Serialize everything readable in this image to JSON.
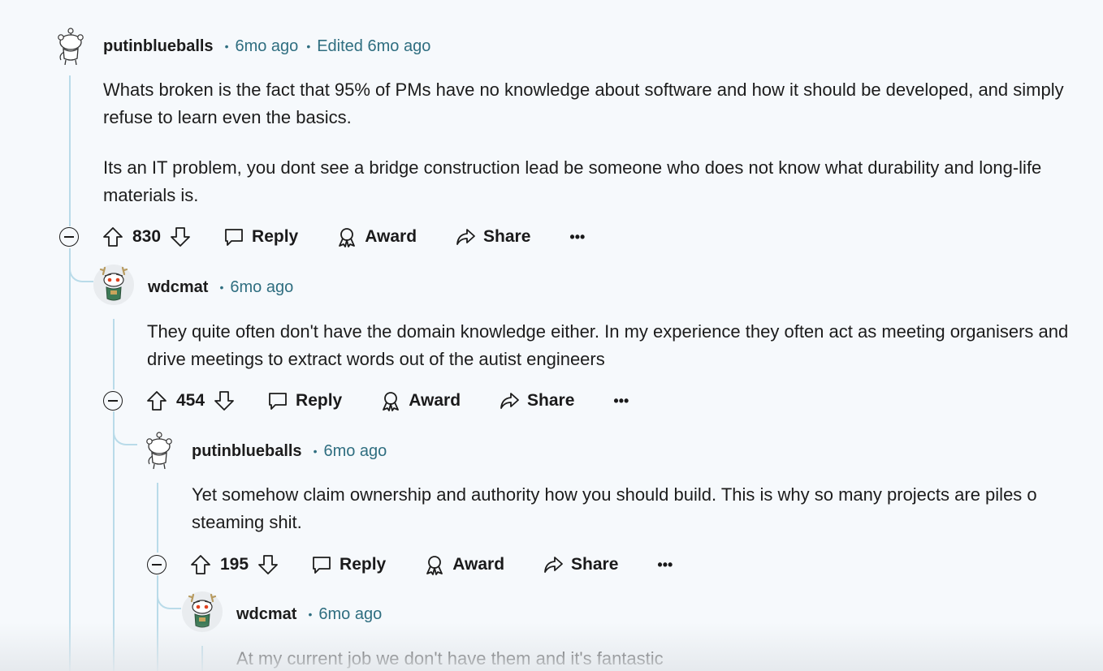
{
  "comments": [
    {
      "username": "putinblueballs",
      "time": "6mo ago",
      "edited": "Edited 6mo ago",
      "paragraphs": [
        "Whats broken is the fact that 95% of PMs have no knowledge about software and how it should be developed, and simply refuse to learn even the basics.",
        "Its an IT problem, you dont see a bridge construction lead be someone who does not know what durability and long-life materials is."
      ],
      "score": "830",
      "avatar_icon": "snoo-default-avatar-icon"
    },
    {
      "username": "wdcmat",
      "time": "6mo ago",
      "paragraphs": [
        "They quite often don't have the domain knowledge either. In my experience they often act as meeting organisers and drive meetings to extract words out of the autist engineers"
      ],
      "score": "454",
      "avatar_icon": "snoo-antlers-avatar-icon"
    },
    {
      "username": "putinblueballs",
      "time": "6mo ago",
      "paragraphs": [
        "Yet somehow claim ownership and authority how you should build. This is why so many projects are piles o steaming shit."
      ],
      "score": "195",
      "avatar_icon": "snoo-default-avatar-icon"
    },
    {
      "username": "wdcmat",
      "time": "6mo ago",
      "paragraphs": [
        "At my current job we don't have them and it's fantastic"
      ],
      "avatar_icon": "snoo-antlers-avatar-icon"
    }
  ],
  "actions": {
    "reply": "Reply",
    "award": "Award",
    "share": "Share",
    "more": "•••"
  },
  "colors": {
    "background": "#f6f9fc",
    "meta": "#2f6e80",
    "thread_line": "#b9dbe9"
  }
}
